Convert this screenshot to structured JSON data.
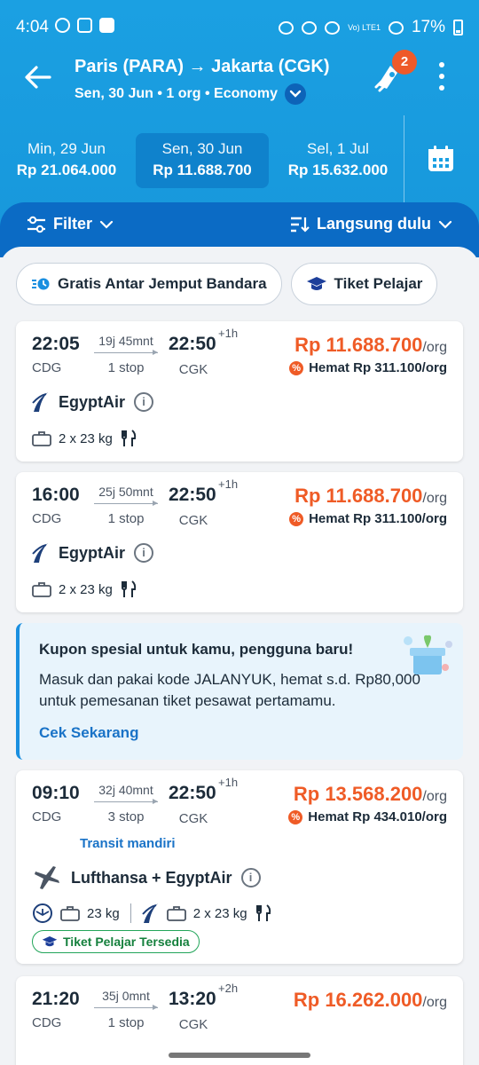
{
  "status": {
    "time": "4:04",
    "battery": "17%",
    "net": "Vo) LTE1"
  },
  "header": {
    "route": "Paris (PARA) → Jakarta (CGK)",
    "subtitle": "Sen, 30 Jun • 1 org • Economy",
    "notification_count": "2"
  },
  "dates": [
    {
      "day": "Min, 29 Jun",
      "price": "Rp 21.064.000",
      "selected": false
    },
    {
      "day": "Sen, 30 Jun",
      "price": "Rp 11.688.700",
      "selected": true
    },
    {
      "day": "Sel, 1 Jul",
      "price": "Rp 15.632.000",
      "selected": false
    }
  ],
  "toolbar": {
    "filter": "Filter",
    "sort": "Langsung dulu"
  },
  "chips": [
    "Gratis Antar Jemput Bandara",
    "Tiket Pelajar"
  ],
  "flights": [
    {
      "dep": "22:05",
      "dep_code": "CDG",
      "duration": "19j 45mnt",
      "stops": "1 stop",
      "arr": "22:50",
      "arr_code": "CGK",
      "plus": "+1h",
      "price": "Rp 11.688.700",
      "per": "/org",
      "save": "Hemat Rp 311.100/org",
      "airline": "EgyptAir",
      "bag": "2 x 23 kg"
    },
    {
      "dep": "16:00",
      "dep_code": "CDG",
      "duration": "25j 50mnt",
      "stops": "1 stop",
      "arr": "22:50",
      "arr_code": "CGK",
      "plus": "+1h",
      "price": "Rp 11.688.700",
      "per": "/org",
      "save": "Hemat Rp 311.100/org",
      "airline": "EgyptAir",
      "bag": "2 x 23 kg"
    },
    {
      "dep": "09:10",
      "dep_code": "CDG",
      "duration": "32j 40mnt",
      "stops": "3 stop",
      "arr": "22:50",
      "arr_code": "CGK",
      "plus": "+1h",
      "price": "Rp 13.568.200",
      "per": "/org",
      "save": "Hemat Rp 434.010/org",
      "transit": "Transit mandiri",
      "airline": "Lufthansa + EgyptAir",
      "bag1": "23 kg",
      "bag2": "2 x 23 kg",
      "student": "Tiket Pelajar Tersedia"
    },
    {
      "dep": "21:20",
      "dep_code": "CDG",
      "duration": "35j 0mnt",
      "stops": "1 stop",
      "arr": "13:20",
      "arr_code": "CGK",
      "plus": "+2h",
      "price": "Rp 16.262.000",
      "per": "/org"
    }
  ],
  "coupon": {
    "title": "Kupon spesial untuk kamu, pengguna baru!",
    "body": "Masuk dan pakai kode JALANYUK, hemat s.d. Rp80,000 untuk pemesanan tiket pesawat pertamamu.",
    "link": "Cek Sekarang"
  },
  "colors": {
    "brand": "#1ba0e2",
    "price": "#ef5b26",
    "link": "#1a73c7"
  }
}
